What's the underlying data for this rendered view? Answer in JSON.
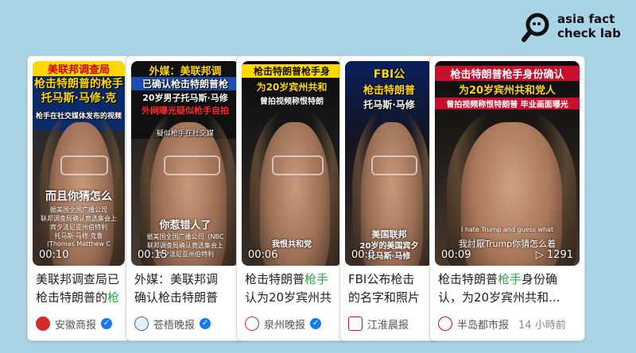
{
  "brand": {
    "line1": "asia fact",
    "line2": "check lab"
  },
  "cards": [
    {
      "top_caption": "美联邦调查局",
      "caption2": "枪击特朗普的枪手",
      "caption3": "托马斯·马修·克",
      "small_caption": "枪手在社交媒体发布的视频",
      "subtitle": "而且你猜怎么",
      "lower_text1": "据美国全国广播公司",
      "lower_text2": "联邦调查局确认竟选集会上",
      "lower_text3": "宾夕法尼亚州伯特利",
      "lower_text4": "托马斯·马修·克鲁",
      "lower_text5": "(Thomas Matthew C",
      "time": "00:10",
      "title_prefix": "美联邦调查局已",
      "title_rest": "枪击特朗普的",
      "title_highlight": "枪",
      "source": "安徽商报"
    },
    {
      "top_caption": "外媒：美联邦调",
      "caption2": "已确认枪击特朗普枪",
      "caption3": "20岁男子托马斯·马修",
      "red_caption": "外网曝光疑似枪手自拍",
      "small_caption": "疑似枪手在社交媒",
      "subtitle": "你惹错人了",
      "lower_text1": "据美国全国广播公司（NBC",
      "lower_text2": "联邦调查局确认竟选集会上",
      "lower_text3": "宾夕法尼亚州伯特利",
      "time": "00:15",
      "title_prefix": "外媒：美联邦调",
      "title_rest": "确认枪击特朗普",
      "title_highlight": "",
      "source": "苍梧晚报"
    },
    {
      "top_caption": "枪击特朗普枪手身",
      "caption2": "为20岁宾州共和",
      "caption3": "曾拍视频称恨特朗",
      "subtitle": "我恨共和党",
      "time": "00:06",
      "title_prefix": "枪击特朗普",
      "title_highlight": "枪手",
      "title_rest": "认为20岁宾州共",
      "source": "泉州晚报"
    },
    {
      "top_caption": "FBI公",
      "caption2": "枪击特朗普",
      "caption3": "托马斯·马修",
      "subtitle": "美国联邦",
      "subtitle2": "20岁的美国宾夕",
      "subtitle3": "托马斯·马修",
      "time": "00:0",
      "title_prefix": "FBI公布枪击",
      "title_rest": "的名字和照片",
      "title_highlight": "",
      "source": "江淮晨报"
    },
    {
      "top_caption": "枪击特朗普枪手身份确认",
      "caption2": "为20岁宾州共和党人",
      "caption3": "曾拍视频称恨特朗普 毕业画面曝光",
      "english_caption": "I hate Trump and guess what",
      "subtitle": "我討厭Trump你猜怎么着",
      "time": "00:09",
      "views": "1291",
      "title_prefix": "枪击特朗普",
      "title_highlight": "枪手",
      "title_rest": "身份确认，为20岁宾州共和...",
      "source": "半岛都市报",
      "ago": "14 小時前"
    }
  ],
  "colors": {
    "background": "#a8d4e6",
    "highlight": "#2ea84a",
    "verify_blue": "#1877f2"
  }
}
